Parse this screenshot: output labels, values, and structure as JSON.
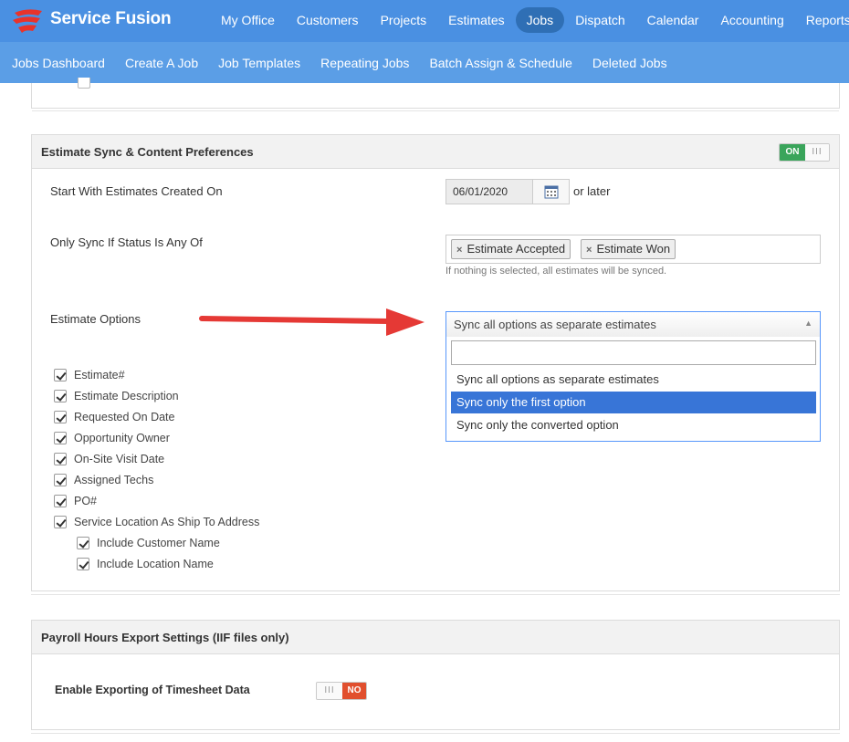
{
  "app": {
    "brand": "Service Fusion",
    "brand_color": "#4a90e2"
  },
  "topnav": [
    {
      "label": "My Office"
    },
    {
      "label": "Customers"
    },
    {
      "label": "Projects"
    },
    {
      "label": "Estimates"
    },
    {
      "label": "Jobs",
      "active": true
    },
    {
      "label": "Dispatch"
    },
    {
      "label": "Calendar"
    },
    {
      "label": "Accounting"
    },
    {
      "label": "Reports"
    }
  ],
  "subnav": [
    {
      "label": "Jobs Dashboard"
    },
    {
      "label": "Create A Job"
    },
    {
      "label": "Job Templates"
    },
    {
      "label": "Repeating Jobs"
    },
    {
      "label": "Batch Assign & Schedule"
    },
    {
      "label": "Deleted Jobs"
    }
  ],
  "estimate_panel": {
    "title": "Estimate Sync & Content Preferences",
    "toggle_on": "ON",
    "toggle_grip": "III",
    "start_label": "Start With Estimates Created On",
    "start_date": "06/01/2020",
    "or_later": "or later",
    "status_label": "Only Sync If Status Is Any Of",
    "status_tags": [
      "Estimate Accepted",
      "Estimate Won"
    ],
    "tag_remove": "×",
    "status_hint": "If nothing is selected, all estimates will be synced.",
    "options_label": "Estimate Options",
    "options_selected": "Sync all options as separate estimates",
    "options_list": [
      {
        "label": "Sync all options as separate estimates",
        "highlighted": false
      },
      {
        "label": "Sync only the first option",
        "highlighted": true
      },
      {
        "label": "Sync only the converted option",
        "highlighted": false
      }
    ],
    "search_value": "",
    "checkboxes": [
      {
        "label": "Estimate#",
        "checked": true
      },
      {
        "label": "Estimate Description",
        "checked": true
      },
      {
        "label": "Requested On Date",
        "checked": true
      },
      {
        "label": "Opportunity Owner",
        "checked": true
      },
      {
        "label": "On-Site Visit Date",
        "checked": true
      },
      {
        "label": "Assigned Techs",
        "checked": true
      },
      {
        "label": "PO#",
        "checked": true
      },
      {
        "label": "Service Location As Ship To Address",
        "checked": true
      }
    ],
    "sub_checkboxes": [
      {
        "label": "Include Customer Name",
        "checked": true
      },
      {
        "label": "Include Location Name",
        "checked": true
      }
    ]
  },
  "payroll_panel": {
    "title": "Payroll Hours Export Settings (IIF files only)",
    "enable_label": "Enable Exporting of Timesheet Data",
    "toggle_off": "NO",
    "toggle_grip": "III"
  },
  "colors": {
    "on": "#3aa55b",
    "off": "#e14f2e",
    "highlight": "#3875d7",
    "arrow": "#e53935"
  }
}
